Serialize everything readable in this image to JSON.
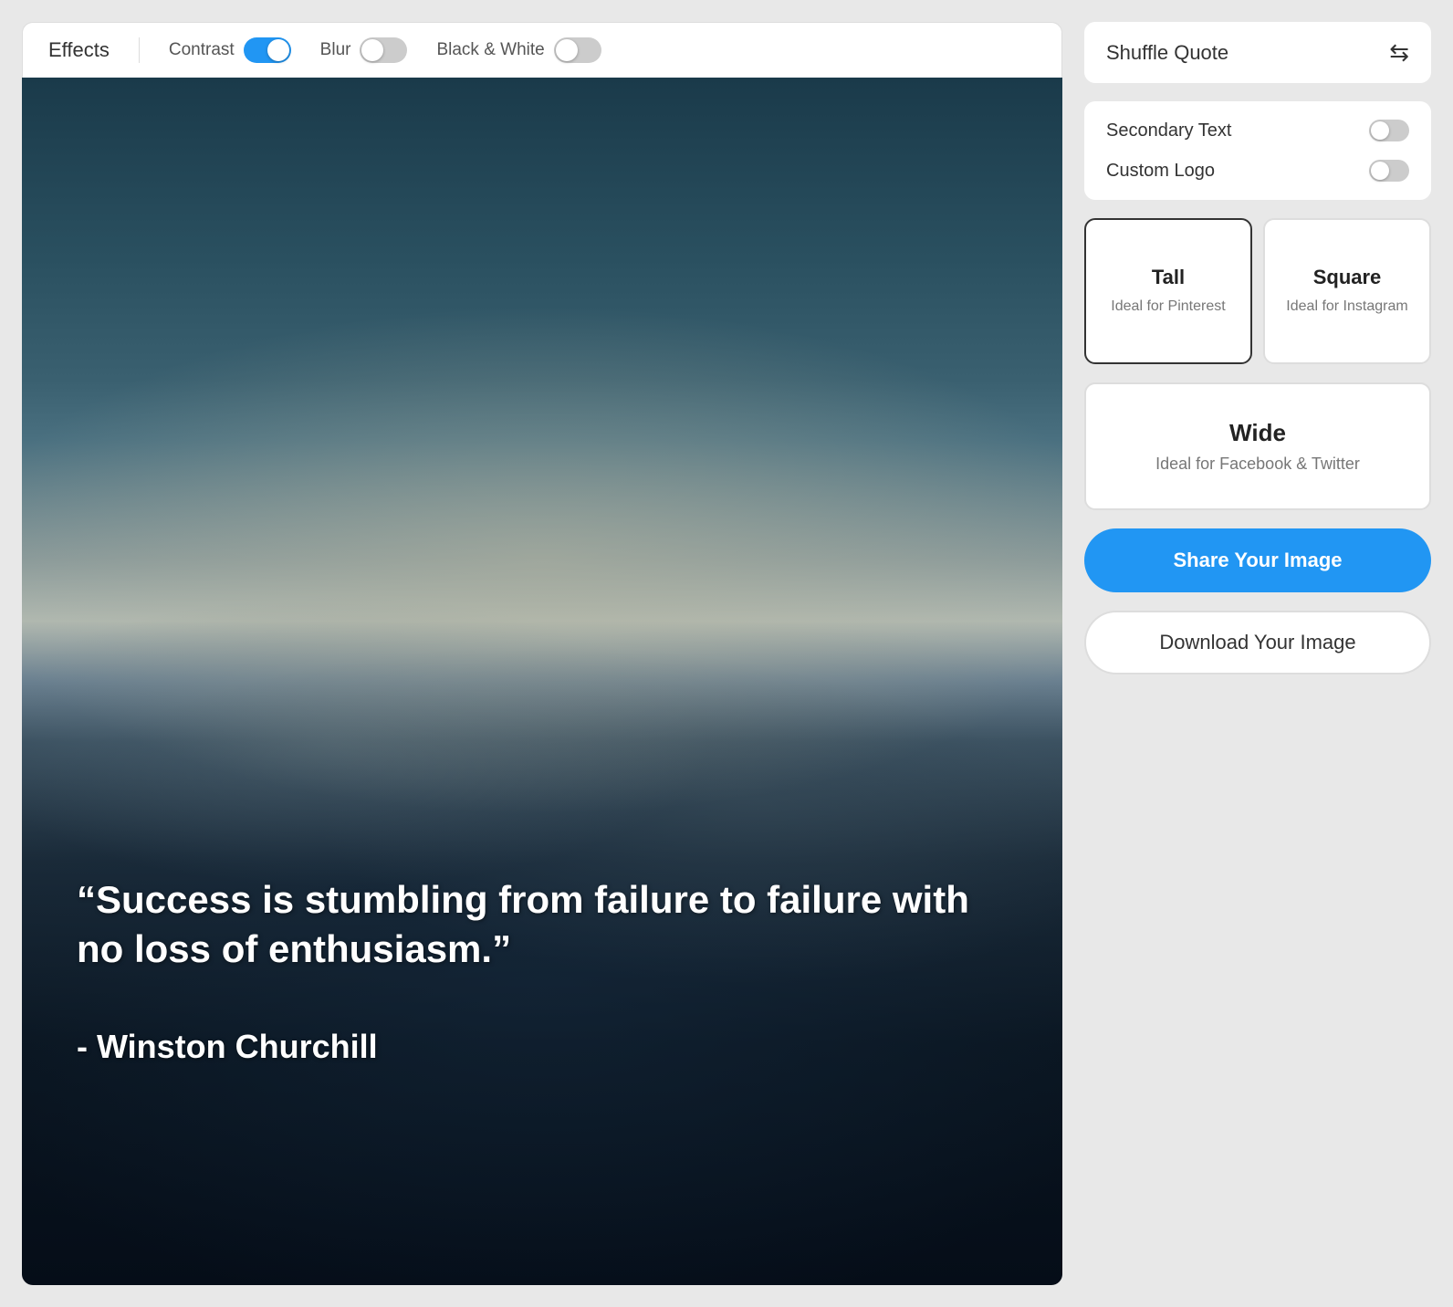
{
  "effects": {
    "label": "Effects",
    "contrast": {
      "label": "Contrast",
      "state": "on"
    },
    "blur": {
      "label": "Blur",
      "state": "off"
    },
    "blackAndWhite": {
      "label": "Black & White",
      "state": "off"
    }
  },
  "quote": {
    "text": "“Success is stumbling from failure to failure with no loss of enthusiasm.”",
    "author": "- Winston Churchill"
  },
  "sidebar": {
    "shuffleQuote": {
      "label": "Shuffle Quote"
    },
    "secondaryText": {
      "label": "Secondary Text",
      "state": "off"
    },
    "customLogo": {
      "label": "Custom Logo",
      "state": "off"
    },
    "formats": {
      "tall": {
        "title": "Tall",
        "subtitle": "Ideal for Pinterest",
        "selected": true
      },
      "square": {
        "title": "Square",
        "subtitle": "Ideal for Instagram",
        "selected": false
      },
      "wide": {
        "title": "Wide",
        "subtitle": "Ideal for Facebook & Twitter",
        "selected": false
      }
    },
    "shareButton": "Share Your Image",
    "downloadButton": "Download Your Image"
  }
}
